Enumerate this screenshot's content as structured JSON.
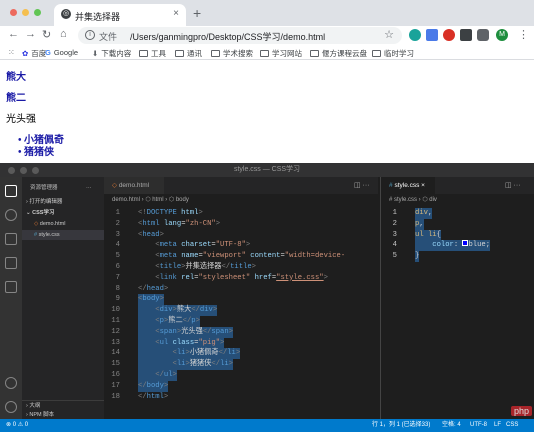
{
  "browser": {
    "tab_title": "并集选择器",
    "tab_close": "×",
    "new_tab": "+",
    "address_label": "文件",
    "address_url": "/Users/ganmingpro/Desktop/CSS学习/demo.html",
    "profile_initial": "M",
    "bookmarks": [
      "百度",
      "Google",
      "下载内容",
      "工具",
      "通讯",
      "学术搜索",
      "学习网站",
      "偃方课程云盘",
      "临时学习"
    ]
  },
  "page": {
    "h1": "熊大",
    "p": "熊二",
    "span": "光头强",
    "list": [
      "小猪佩奇",
      "猪猪侠"
    ]
  },
  "vscode": {
    "window_title": "style.css — CSS学习",
    "explorer_title": "资源管理器",
    "open_editors": "打开的编辑器",
    "folder": "CSS学习",
    "files": [
      "demo.html",
      "style.css"
    ],
    "outline": "大纲",
    "npm": "NPM 脚本",
    "left_tab": "demo.html",
    "left_crumb": "demo.html  ›  ⬡ html  ›  ⬡ body",
    "right_tab": "style.css",
    "right_crumb": "# style.css  ›  ⬡ div",
    "status": {
      "problems": "⊗ 0  ⚠ 0",
      "position": "行 1，列 1 (已选择33)",
      "spaces": "空格: 4",
      "encoding": "UTF-8",
      "eol": "LF",
      "lang": "CSS"
    }
  },
  "watermark": "php"
}
